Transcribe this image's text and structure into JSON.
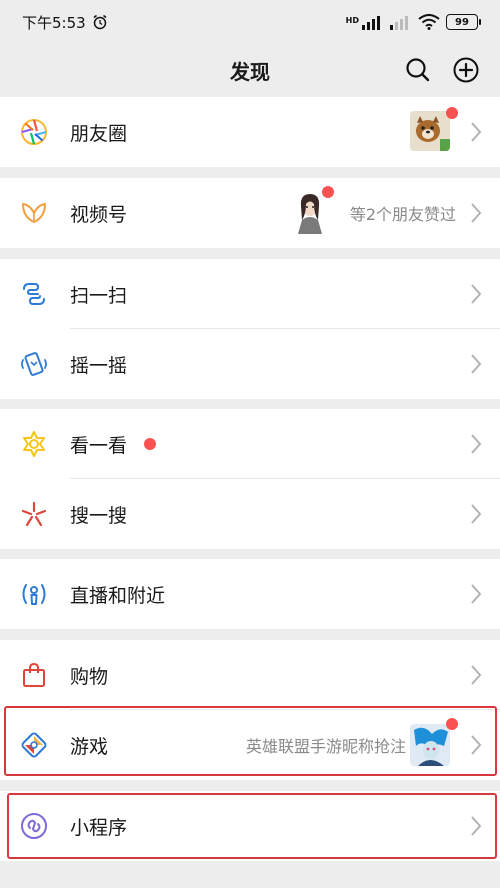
{
  "status_bar": {
    "time": "下午5:53",
    "hd": "HD",
    "battery": "99"
  },
  "nav": {
    "title": "发现"
  },
  "items": [
    {
      "label": "朋友圈"
    },
    {
      "label": "视频号",
      "sub": "等2个朋友赞过"
    },
    {
      "label": "扫一扫"
    },
    {
      "label": "摇一摇"
    },
    {
      "label": "看一看"
    },
    {
      "label": "搜一搜"
    },
    {
      "label": "直播和附近"
    },
    {
      "label": "购物"
    },
    {
      "label": "游戏",
      "sub": "英雄联盟手游昵称抢注"
    },
    {
      "label": "小程序"
    }
  ],
  "colors": {
    "accent_red": "#fa5151",
    "highlight_outline": "#d9363e"
  }
}
